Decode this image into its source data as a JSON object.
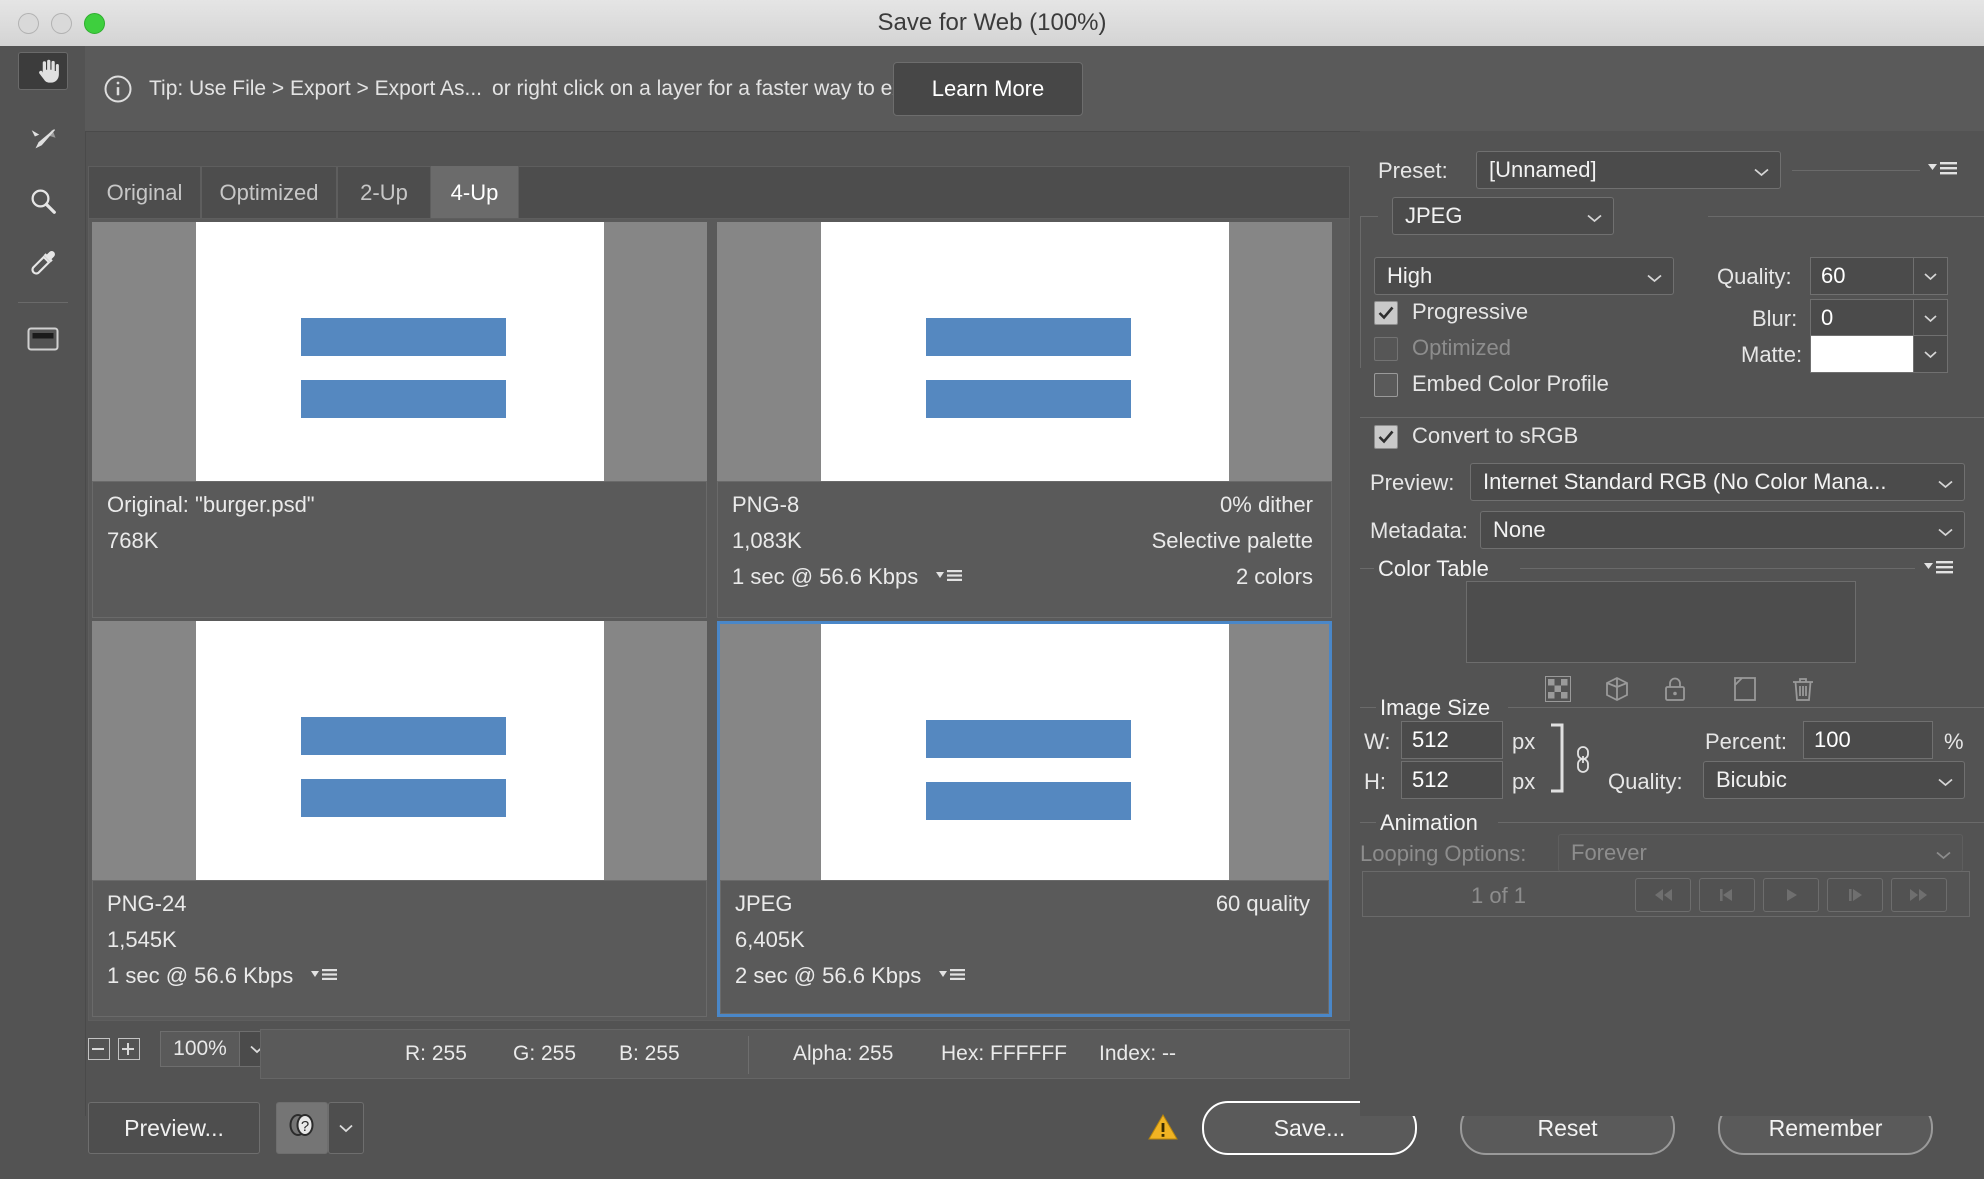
{
  "window": {
    "title": "Save for Web (100%)",
    "traffic_lights": [
      "close",
      "minimize",
      "maximize"
    ]
  },
  "tip": {
    "icon": "info-icon",
    "text_a": "Tip: Use File > Export > Export As...",
    "text_b": "or right click on a layer for a faster way to export assets",
    "learn_more": "Learn More"
  },
  "toolbar": {
    "items": [
      {
        "name": "hand-tool",
        "selected": true
      },
      {
        "name": "slice-select-tool",
        "selected": false
      },
      {
        "name": "zoom-tool",
        "selected": false
      },
      {
        "name": "eyedropper-tool",
        "selected": false
      },
      {
        "name": "toggle-slices-tool",
        "selected": false
      }
    ]
  },
  "tabs": [
    {
      "label": "Original",
      "active": false
    },
    {
      "label": "Optimized",
      "active": false
    },
    {
      "label": "2-Up",
      "active": false
    },
    {
      "label": "4-Up",
      "active": true
    }
  ],
  "previews": [
    {
      "id": "original",
      "selected": false,
      "left_lines": [
        "Original: \"burger.psd\"",
        "768K",
        ""
      ],
      "right_lines": [
        "",
        "",
        ""
      ],
      "has_popup_menu": false
    },
    {
      "id": "png8",
      "selected": false,
      "left_lines": [
        "PNG-8",
        "1,083K",
        "1 sec @ 56.6 Kbps"
      ],
      "right_lines": [
        "0% dither",
        "Selective palette",
        "2 colors"
      ],
      "has_popup_menu": true
    },
    {
      "id": "png24",
      "selected": false,
      "left_lines": [
        "PNG-24",
        "1,545K",
        "1 sec @ 56.6 Kbps"
      ],
      "right_lines": [
        "",
        "",
        ""
      ],
      "has_popup_menu": true
    },
    {
      "id": "jpeg",
      "selected": true,
      "left_lines": [
        "JPEG",
        "6,405K",
        "2 sec @ 56.6 Kbps"
      ],
      "right_lines": [
        "60 quality",
        "",
        ""
      ],
      "has_popup_menu": true
    }
  ],
  "artwork": {
    "background": "#ffffff",
    "bar_color": "#5588c0",
    "canvas_matte": "#868686"
  },
  "status": {
    "zoom_out": "−",
    "zoom_in": "+",
    "zoom_value": "100%",
    "r": "R: 255",
    "g": "G: 255",
    "b": "B: 255",
    "alpha": "Alpha: 255",
    "hex": "Hex: FFFFFF",
    "index": "Index: --"
  },
  "settings": {
    "preset_label": "Preset:",
    "preset_value": "[Unnamed]",
    "format_value": "JPEG",
    "compression_value": "High",
    "quality_label": "Quality:",
    "quality_value": "60",
    "progressive_label": "Progressive",
    "progressive_checked": true,
    "blur_label": "Blur:",
    "blur_value": "0",
    "optimized_label": "Optimized",
    "optimized_checked": false,
    "optimized_disabled": true,
    "matte_label": "Matte:",
    "matte_color": "#ffffff",
    "embed_color_profile_label": "Embed Color Profile",
    "embed_color_profile_checked": false,
    "convert_srgb_label": "Convert to sRGB",
    "convert_srgb_checked": true,
    "preview_label": "Preview:",
    "preview_value": "Internet Standard RGB (No Color Mana...",
    "metadata_label": "Metadata:",
    "metadata_value": "None"
  },
  "color_table": {
    "title": "Color Table",
    "icons": [
      "transparency-icon",
      "web-shift-icon",
      "lock-icon",
      "new-color-icon",
      "trash-icon"
    ]
  },
  "image_size": {
    "title": "Image Size",
    "w_label": "W:",
    "w_value": "512",
    "w_unit": "px",
    "h_label": "H:",
    "h_value": "512",
    "h_unit": "px",
    "link_icon": "chain-link-icon",
    "percent_label": "Percent:",
    "percent_value": "100",
    "percent_unit": "%",
    "quality_label": "Quality:",
    "quality_value": "Bicubic"
  },
  "animation": {
    "title": "Animation",
    "looping_label": "Looping Options:",
    "looping_value": "Forever",
    "frame_counter": "1 of 1",
    "controls": [
      "first-frame",
      "previous-frame",
      "play",
      "next-frame",
      "last-frame"
    ]
  },
  "footer": {
    "preview_label": "Preview...",
    "browser_icon": "browser-select-icon",
    "warning_icon": "warning-icon",
    "save_label": "Save...",
    "reset_label": "Reset",
    "remember_label": "Remember"
  },
  "colors": {
    "accent_selection": "#4a87c8",
    "warning": "#f0b323",
    "panel_bg": "#535353",
    "field_bg": "#4b4b4b"
  }
}
